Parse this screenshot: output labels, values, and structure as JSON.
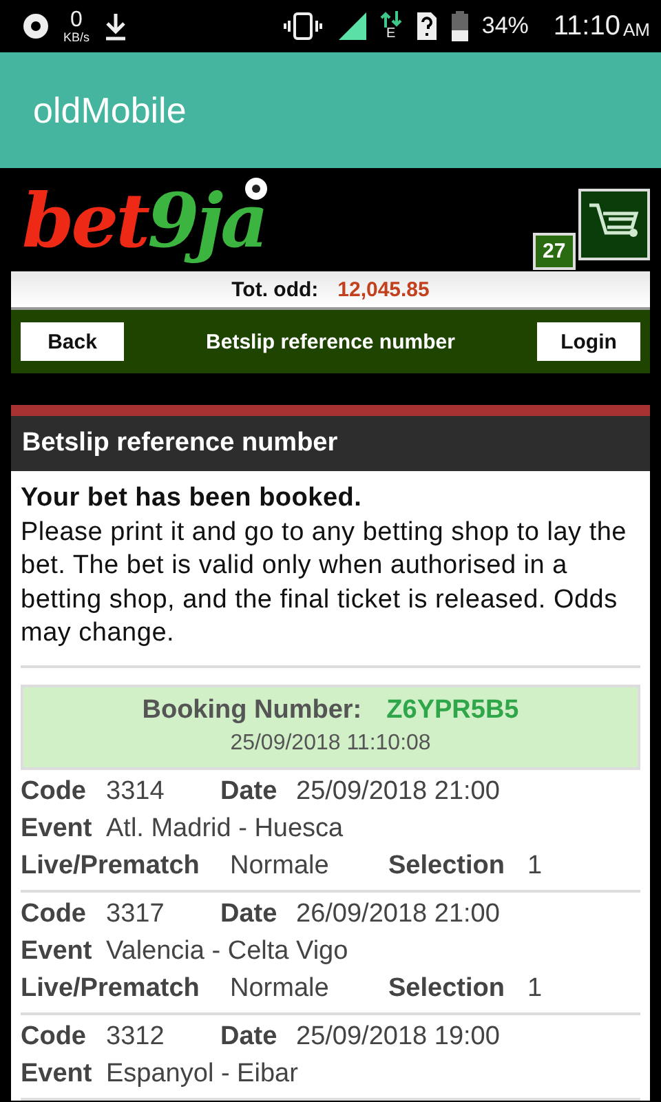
{
  "status_bar": {
    "speed": "0",
    "speed_unit": "KB/s",
    "network": "E",
    "battery": "34%",
    "time": "11:10",
    "ampm": "AM"
  },
  "app_bar": {
    "title": "oldMobile"
  },
  "header": {
    "logo_main": "bet",
    "logo_accent": "9ja",
    "cart_count": "27"
  },
  "total_odds": {
    "label": "Tot. odd:",
    "value": "12,045.85"
  },
  "nav": {
    "back": "Back",
    "title": "Betslip reference number",
    "login": "Login"
  },
  "panel": {
    "title": "Betslip reference number",
    "message_title": "Your bet has been booked.",
    "message": "Please print it and go to any betting shop to lay the bet. The bet is valid only when authorised in a betting shop, and the final ticket is released. Odds may change."
  },
  "booking": {
    "label": "Booking Number:",
    "number": "Z6YPR5B5",
    "timestamp": "25/09/2018 11:10:08"
  },
  "bets": [
    {
      "code_label": "Code",
      "code": "3314",
      "date_label": "Date",
      "date": "25/09/2018 21:00",
      "event_label": "Event",
      "event": "Atl. Madrid - Huesca",
      "type_label": "Live/Prematch",
      "type": "Normale",
      "selection_label": "Selection",
      "selection": "1"
    },
    {
      "code_label": "Code",
      "code": "3317",
      "date_label": "Date",
      "date": "26/09/2018 21:00",
      "event_label": "Event",
      "event": "Valencia - Celta Vigo",
      "type_label": "Live/Prematch",
      "type": "Normale",
      "selection_label": "Selection",
      "selection": "1"
    },
    {
      "code_label": "Code",
      "code": "3312",
      "date_label": "Date",
      "date": "25/09/2018 19:00",
      "event_label": "Event",
      "event": "Espanyol - Eibar"
    }
  ]
}
